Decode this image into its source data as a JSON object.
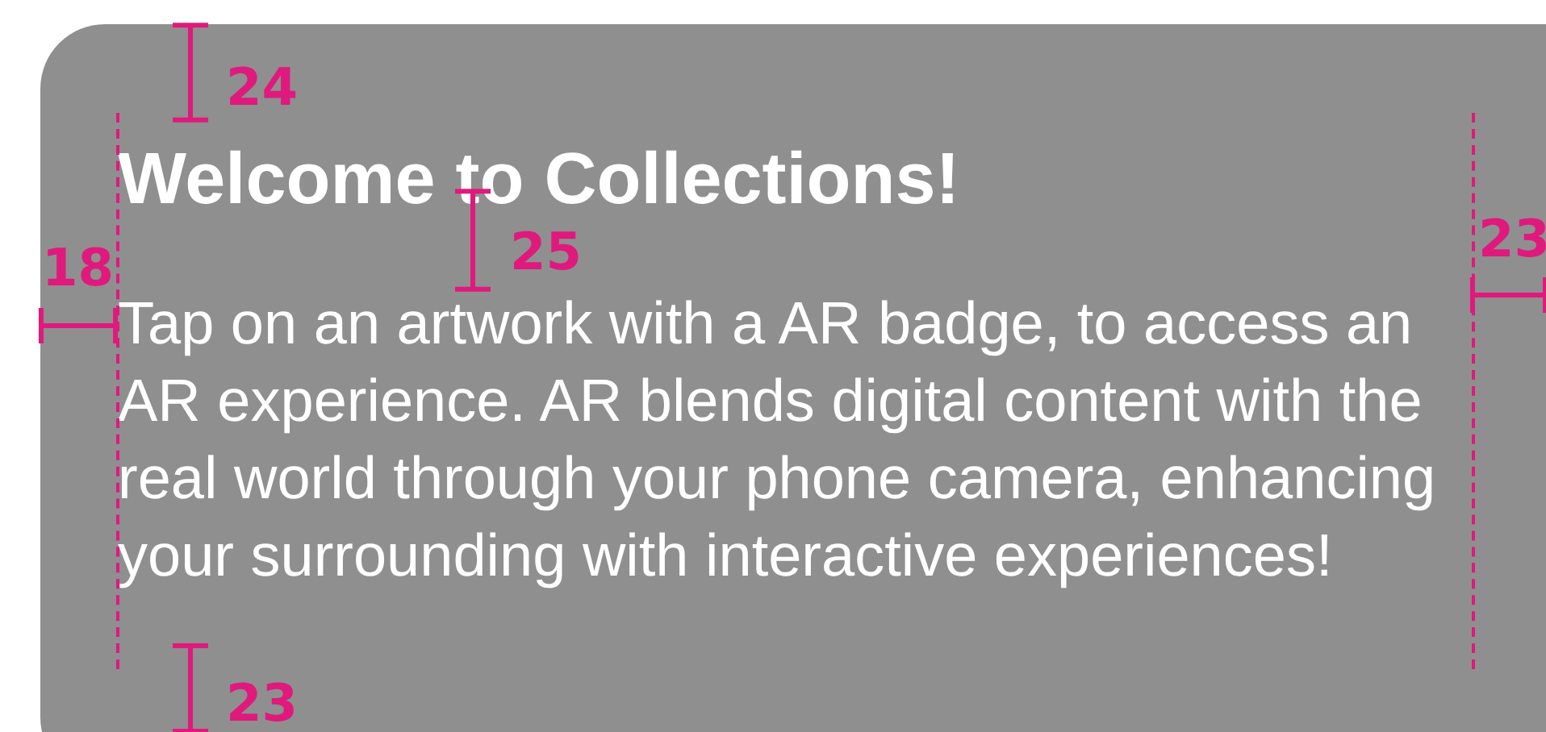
{
  "card": {
    "title": "Welcome to Collections!",
    "body": "Tap on an artwork with a AR badge, to access an AR experience. AR blends digital content with the real world through your phone camera, enhancing your surrounding with interactive experiences!"
  },
  "annotations": [
    {
      "kind": "vertical",
      "label": "24"
    },
    {
      "kind": "vertical",
      "label": "25"
    },
    {
      "kind": "horizontal",
      "label": "18"
    },
    {
      "kind": "horizontal",
      "label": "23"
    },
    {
      "kind": "vertical",
      "label": "23"
    }
  ],
  "guides": [
    {
      "kind": "dashed"
    },
    {
      "kind": "dashed"
    }
  ]
}
